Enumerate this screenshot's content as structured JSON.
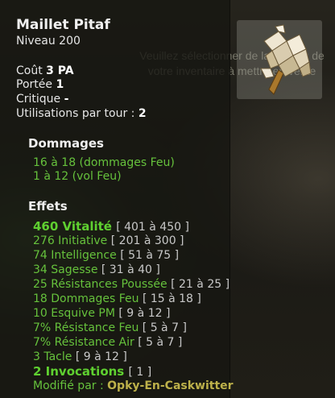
{
  "background": {
    "selection_hint": "Veuillez sélectionner de la liste ou de votre inventaire à mettre en vente"
  },
  "item": {
    "name": "Maillet Pitaf",
    "level": "Niveau  200",
    "icon": "hammer-icon"
  },
  "stats": {
    "cost_label": "Coût",
    "cost_value": "3 PA",
    "range_label": "Portée",
    "range_value": "1",
    "crit_label": "Critique",
    "crit_value": "-",
    "uses_label": "Utilisations par tour :",
    "uses_value": "2"
  },
  "damage": {
    "title": "Dommages",
    "lines": [
      "16 à 18 (dommages Feu)",
      "1 à 12 (vol Feu)"
    ]
  },
  "effects": {
    "title": "Effets",
    "lines": [
      {
        "text": "460 Vitalité",
        "range": "[ 401 à 450 ]"
      },
      {
        "text": "276 Initiative",
        "range": "[ 201 à 300 ]"
      },
      {
        "text": "74 Intelligence",
        "range": "[ 51 à 75 ]"
      },
      {
        "text": "34 Sagesse",
        "range": "[ 31 à 40 ]"
      },
      {
        "text": "25 Résistances Poussée",
        "range": "[ 21 à 25 ]"
      },
      {
        "text": "18 Dommages Feu",
        "range": "[ 15 à 18 ]"
      },
      {
        "text": "10 Esquive PM",
        "range": "[ 9 à 12 ]"
      },
      {
        "text": "7% Résistance Feu",
        "range": "[ 5 à 7 ]"
      },
      {
        "text": "7% Résistance Air",
        "range": "[ 5 à 7 ]"
      },
      {
        "text": "3 Tacle",
        "range": "[ 9 à 12 ]"
      },
      {
        "text": "2 Invocations",
        "range": "[ 1 ]"
      }
    ],
    "modified_by_label": "Modifié par :",
    "modified_by_author": "Opky-En-Caskwitter"
  },
  "colors": {
    "effect_green": "#66c23c",
    "author_gold": "#bdb14a"
  }
}
